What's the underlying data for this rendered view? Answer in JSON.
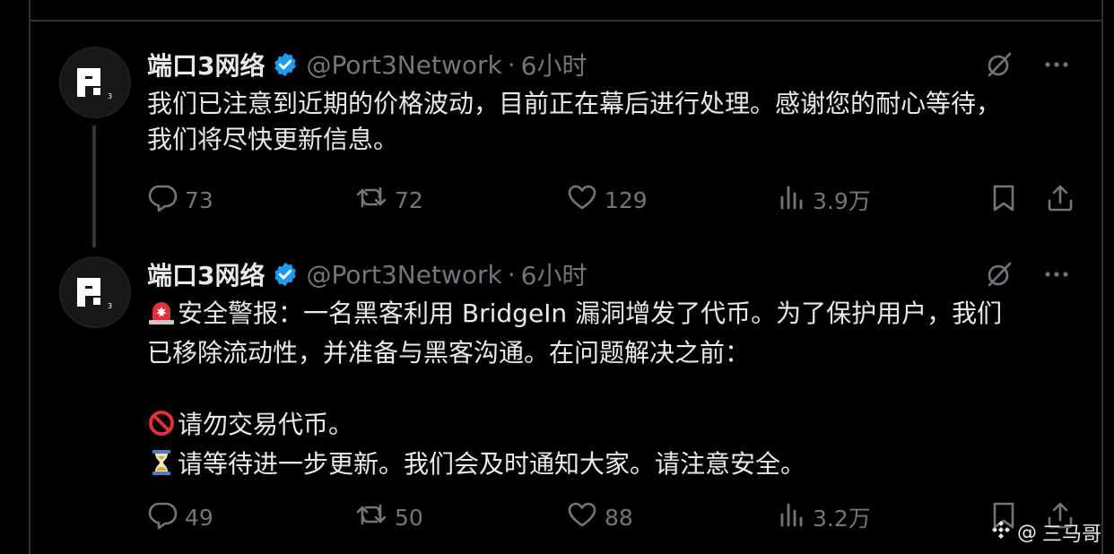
{
  "author": {
    "name": "端口3网络",
    "handle": "@Port3Network",
    "separator": "·"
  },
  "tweets": [
    {
      "time": "6小时",
      "lines": [
        "我们已注意到近期的价格波动，目前正在幕后进行处理。感谢您的耐心等待，",
        "我们将尽快更新信息。"
      ],
      "replies": "73",
      "retweets": "72",
      "likes": "129",
      "views": "3.9万"
    },
    {
      "time": "6小时",
      "line1": "安全警报：一名黑客利用 BridgeIn 漏洞增发了代币。为了保护用户，我们",
      "line2": "已移除流动性，并准备与黑客沟通。在问题解决之前：",
      "line3": "请勿交易代币。",
      "line4": "请等待进一步更新。我们会及时通知大家。请注意安全。",
      "replies": "49",
      "retweets": "50",
      "likes": "88",
      "views": "3.2万"
    }
  ],
  "watermark": {
    "prefix": "@",
    "text": "三马哥"
  },
  "icons": {
    "verified": "verified-badge-icon",
    "grok": "grok-icon",
    "more": "more-icon",
    "reply": "reply-icon",
    "retweet": "retweet-icon",
    "like": "like-icon",
    "views": "views-icon",
    "bookmark": "bookmark-icon",
    "share": "share-icon"
  },
  "colors": {
    "background": "#000000",
    "text": "#e7e9ea",
    "muted": "#71767b",
    "verified": "#1d9bf0",
    "border": "#2f3336"
  }
}
